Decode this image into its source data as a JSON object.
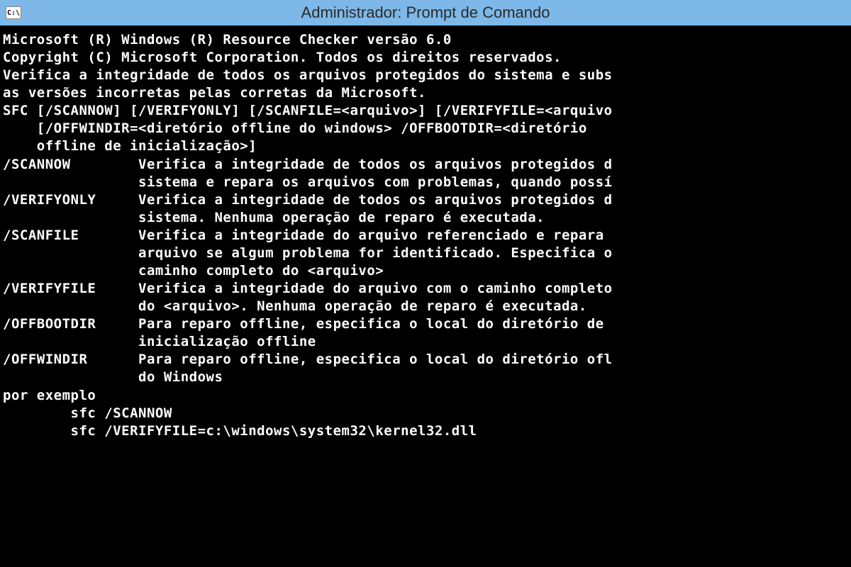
{
  "titlebar": {
    "icon_text": "C:\\",
    "title": "Administrador: Prompt de Comando"
  },
  "terminal": {
    "lines": [
      "",
      "Microsoft (R) Windows (R) Resource Checker versão 6.0",
      "Copyright (C) Microsoft Corporation. Todos os direitos reservados.",
      "",
      "Verifica a integridade de todos os arquivos protegidos do sistema e subs",
      "as versões incorretas pelas corretas da Microsoft.",
      "",
      "SFC [/SCANNOW] [/VERIFYONLY] [/SCANFILE=<arquivo>] [/VERIFYFILE=<arquivo",
      "    [/OFFWINDIR=<diretório offline do windows> /OFFBOOTDIR=<diretório",
      "    offline de inicialização>]",
      "",
      "/SCANNOW        Verifica a integridade de todos os arquivos protegidos d",
      "                sistema e repara os arquivos com problemas, quando possí",
      "/VERIFYONLY     Verifica a integridade de todos os arquivos protegidos d",
      "                sistema. Nenhuma operação de reparo é executada.",
      "/SCANFILE       Verifica a integridade do arquivo referenciado e repara ",
      "                arquivo se algum problema for identificado. Especifica o",
      "                caminho completo do <arquivo>",
      "/VERIFYFILE     Verifica a integridade do arquivo com o caminho completo",
      "                do <arquivo>. Nenhuma operação de reparo é executada.",
      "/OFFBOOTDIR     Para reparo offline, especifica o local do diretório de",
      "                inicialização offline",
      "/OFFWINDIR      Para reparo offline, especifica o local do diretório ofl",
      "                do Windows",
      "",
      "por exemplo",
      "",
      "        sfc /SCANNOW",
      "        sfc /VERIFYFILE=c:\\windows\\system32\\kernel32.dll"
    ]
  }
}
